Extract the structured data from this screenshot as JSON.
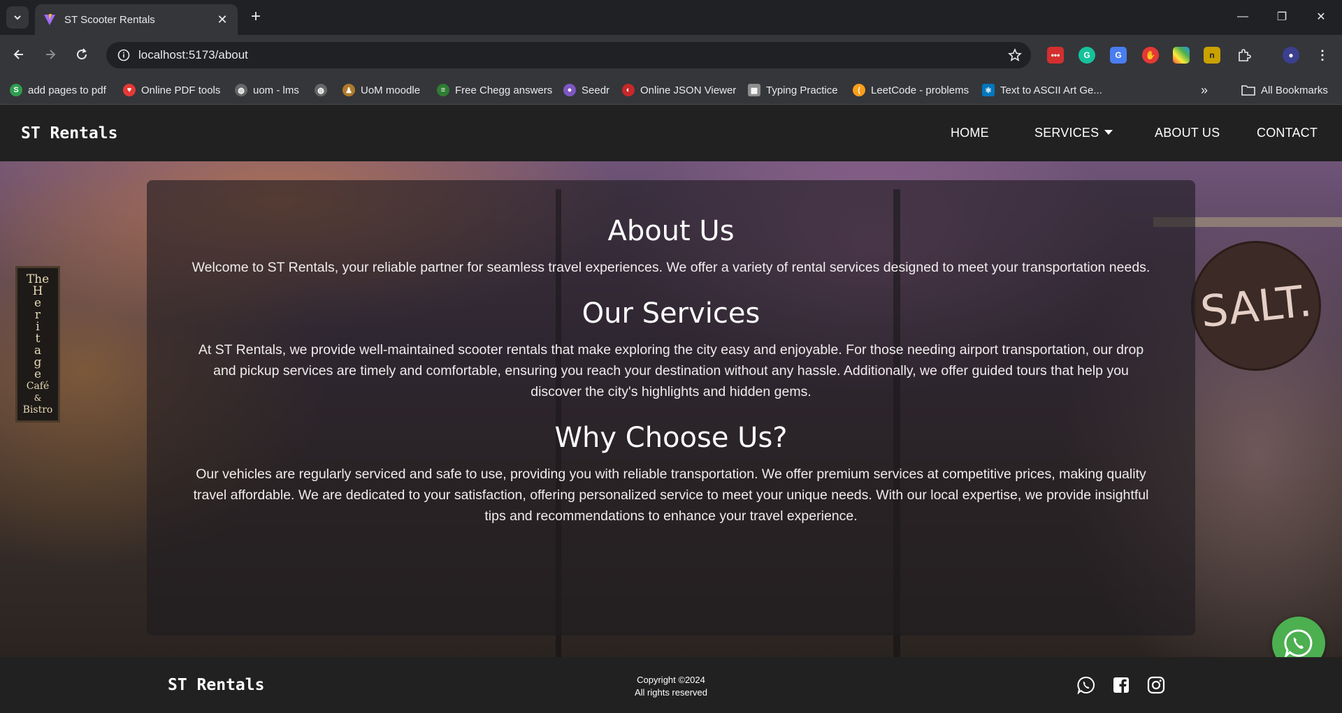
{
  "browser": {
    "tab_title": "ST Scooter Rentals",
    "url": "localhost:5173/about",
    "bookmarks": [
      "add pages to pdf",
      "Online PDF tools",
      "uom - lms",
      "UoM moodle",
      "Free Chegg answers",
      "Seedr",
      "Online JSON Viewer",
      "Typing Practice",
      "LeetCode - problems",
      "Text to ASCII Art Ge..."
    ],
    "all_bookmarks": "All Bookmarks"
  },
  "site": {
    "brand": "ST Rentals",
    "nav": {
      "home": "HOME",
      "services": "SERVICES",
      "about": "ABOUT US",
      "contact": "CONTACT"
    },
    "sections": [
      {
        "heading": "About Us",
        "text": "Welcome to ST Rentals, your reliable partner for seamless travel experiences. We offer a variety of rental services designed to meet your transportation needs."
      },
      {
        "heading": "Our Services",
        "text": "At ST Rentals, we provide well-maintained scooter rentals that make exploring the city easy and enjoyable. For those needing airport transportation, our drop and pickup services are timely and comfortable, ensuring you reach your destination without any hassle. Additionally, we offer guided tours that help you discover the city's highlights and hidden gems."
      },
      {
        "heading": "Why Choose Us?",
        "text": "Our vehicles are regularly serviced and safe to use, providing you with reliable transportation. We offer premium services at competitive prices, making quality travel affordable. We are dedicated to your satisfaction, offering personalized service to meet your unique needs. With our local expertise, we provide insightful tips and recommendations to enhance your travel experience."
      }
    ],
    "background_signs": {
      "heritage": [
        "The",
        "H",
        "e",
        "r",
        "i",
        "t",
        "a",
        "g",
        "e",
        "Café",
        "&",
        "Bistro"
      ],
      "salt": "SALT."
    },
    "footer": {
      "brand": "ST Rentals",
      "copyright": "Copyright ©2024",
      "rights": "All rights reserved"
    },
    "colors": {
      "header_bg": "#212121",
      "whatsapp": "#4caf50"
    }
  }
}
